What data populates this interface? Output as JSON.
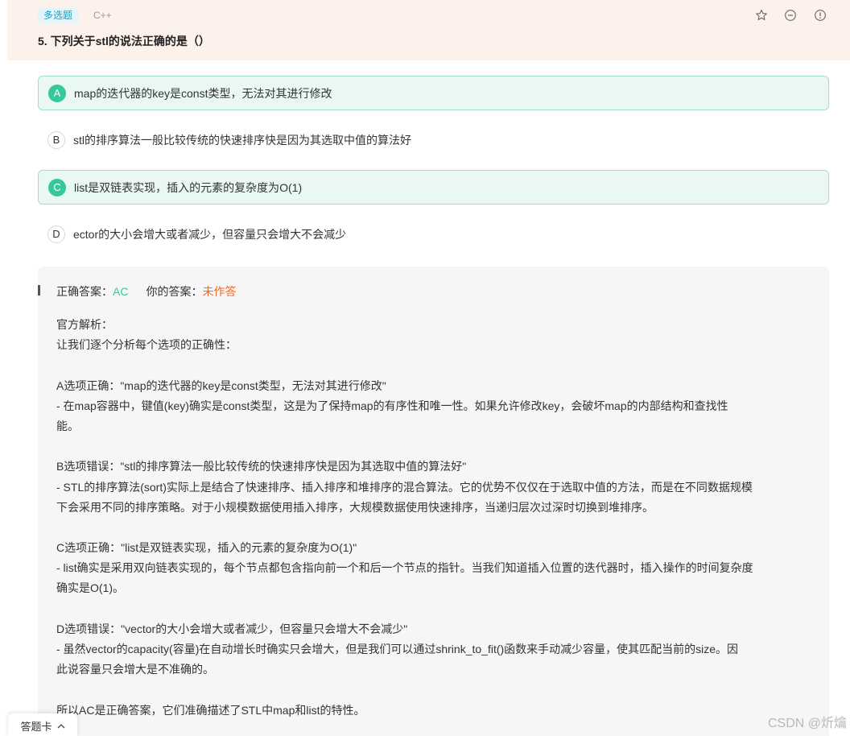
{
  "header": {
    "type_tag": "多选题",
    "lang_tag": "C++",
    "title": "5. 下列关于stl的说法正确的是（）",
    "icons": [
      "star-icon",
      "minus-circle-icon",
      "info-circle-icon"
    ]
  },
  "options": [
    {
      "letter": "A",
      "text": "map的迭代器的key是const类型，无法对其进行修改",
      "correct": true
    },
    {
      "letter": "B",
      "text": "stl的排序算法一般比较传统的快速排序快是因为其选取中值的算法好",
      "correct": false
    },
    {
      "letter": "C",
      "text": "list是双链表实现，插入的元素的复杂度为O(1)",
      "correct": true
    },
    {
      "letter": "D",
      "text": "ector的大小会增大或者减少，但容量只会增大不会减少",
      "correct": false
    }
  ],
  "analysis": {
    "correct_label": "正确答案：",
    "correct_value": "AC",
    "your_label": "你的答案：",
    "your_value": "未作答",
    "lines": [
      "官方解析：",
      "让我们逐个分析每个选项的正确性：",
      "",
      "A选项正确：\"map的迭代器的key是const类型，无法对其进行修改\"",
      "- 在map容器中，键值(key)确实是const类型，这是为了保持map的有序性和唯一性。如果允许修改key，会破坏map的内部结构和查找性",
      "能。",
      "",
      "B选项错误：\"stl的排序算法一般比较传统的快速排序快是因为其选取中值的算法好\"",
      "- STL的排序算法(sort)实际上是结合了快速排序、插入排序和堆排序的混合算法。它的优势不仅仅在于选取中值的方法，而是在不同数据规模",
      "下会采用不同的排序策略。对于小规模数据使用插入排序，大规模数据使用快速排序，当递归层次过深时切换到堆排序。",
      "",
      "C选项正确：\"list是双链表实现，插入的元素的复杂度为O(1)\"",
      "- list确实是采用双向链表实现的，每个节点都包含指向前一个和后一个节点的指针。当我们知道插入位置的迭代器时，插入操作的时间复杂度",
      "确实是O(1)。",
      "",
      "D选项错误：\"vector的大小会增大或者减少，但容量只会增大不会减少\"",
      "- 虽然vector的capacity(容量)在自动增长时确实只会增大，但是我们可以通过shrink_to_fit()函数来手动减少容量，使其匹配当前的size。因",
      "此说容量只会增大是不准确的。",
      "",
      "所以AC是正确答案，它们准确描述了STL中map和list的特性。"
    ]
  },
  "footer": {
    "card_label": "答题卡",
    "watermark": "CSDN @炘爚"
  }
}
